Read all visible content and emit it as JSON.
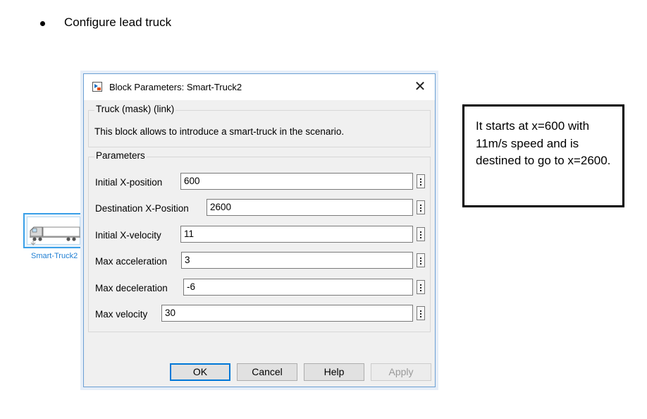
{
  "bullet": {
    "text": "Configure lead truck"
  },
  "block": {
    "label": "Smart-Truck2",
    "icon": "truck-icon"
  },
  "dialog": {
    "title": "Block Parameters: Smart-Truck2",
    "close_symbol": "✕",
    "mask_group_label": "Truck (mask) (link)",
    "description": "This block allows to introduce a smart-truck in the scenario.",
    "parameters_group_label": "Parameters",
    "params": [
      {
        "label": "Initial X-position",
        "value": "600"
      },
      {
        "label": "Destination X-Position",
        "value": "2600"
      },
      {
        "label": "Initial X-velocity",
        "value": "11"
      },
      {
        "label": "Max acceleration",
        "value": "3"
      },
      {
        "label": "Max deceleration",
        "value": "-6"
      },
      {
        "label": "Max velocity",
        "value": "30"
      }
    ],
    "buttons": {
      "ok": "OK",
      "cancel": "Cancel",
      "help": "Help",
      "apply": "Apply"
    }
  },
  "note": {
    "text": "It starts at x=600 with 11m/s speed and is destined to go to x=2600."
  },
  "colors": {
    "accent": "#0078d7",
    "block_border": "#3aa0e8",
    "block_label": "#1f7fd3"
  }
}
